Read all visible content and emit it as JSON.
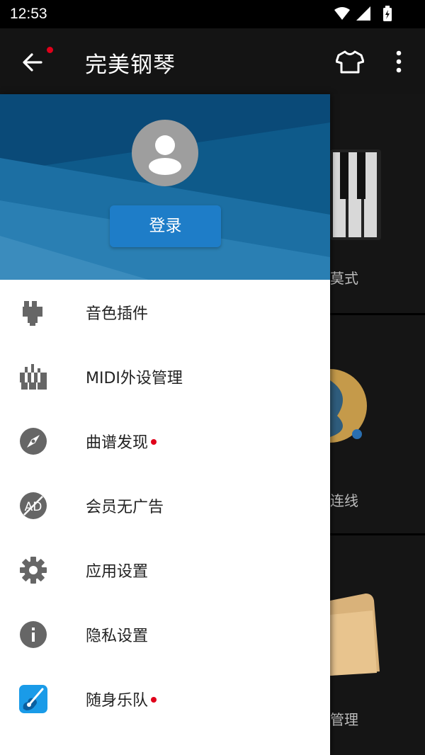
{
  "status_bar": {
    "time": "12:53"
  },
  "app_bar": {
    "title": "完美钢琴",
    "back_icon": "arrow-left-icon",
    "skin_icon": "tshirt-icon",
    "more_icon": "more-vert-icon",
    "notification_dot": true
  },
  "background": {
    "cards": [
      {
        "label": "莫式"
      },
      {
        "label": "连线"
      },
      {
        "label": "管理"
      }
    ]
  },
  "drawer": {
    "login_label": "登录",
    "menu": [
      {
        "label": "音色插件",
        "icon": "plugin-icon",
        "dot": false
      },
      {
        "label": "MIDI外设管理",
        "icon": "midi-keyboard-icon",
        "dot": false
      },
      {
        "label": "曲谱发现",
        "icon": "compass-icon",
        "dot": true
      },
      {
        "label": "会员无广告",
        "icon": "no-ad-icon",
        "dot": false
      },
      {
        "label": "应用设置",
        "icon": "gear-icon",
        "dot": false
      },
      {
        "label": "隐私设置",
        "icon": "info-icon",
        "dot": false
      },
      {
        "label": "随身乐队",
        "icon": "guitar-app-icon",
        "dot": true
      }
    ]
  },
  "colors": {
    "accent": "#1e7dc8",
    "dot": "#e0001a",
    "hero": "#0f5a8b"
  }
}
